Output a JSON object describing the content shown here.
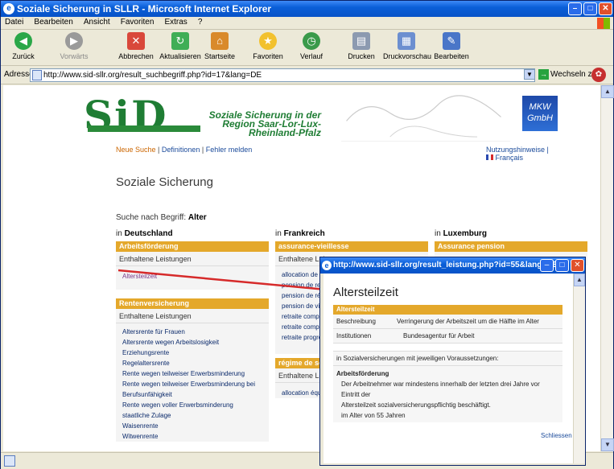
{
  "window": {
    "title": "Soziale Sicherung in SLLR - Microsoft Internet Explorer"
  },
  "menu": [
    "Datei",
    "Bearbeiten",
    "Ansicht",
    "Favoriten",
    "Extras",
    "?"
  ],
  "toolbar": {
    "back": "Zurück",
    "forward": "Vorwärts",
    "stop": "Abbrechen",
    "refresh": "Aktualisieren",
    "home": "Startseite",
    "favorites": "Favoriten",
    "history": "Verlauf",
    "print": "Drucken",
    "preview": "Druckvorschau",
    "edit": "Bearbeiten"
  },
  "address": {
    "label": "Adresse",
    "url": "http://www.sid-sllr.org/result_suchbegriff.php?id=17&lang=DE",
    "go": "Wechseln zu"
  },
  "site": {
    "logo": "SiD",
    "brand": "Soziale Sicherung in der Region Saar-Lor-Lux-Rheinland-Pfalz",
    "partner": "MKW GmbH",
    "nav_left": [
      "Neue Suche",
      "Definitionen",
      "Fehler melden"
    ],
    "nav_right": [
      "Nutzungshinweise",
      "Français"
    ],
    "title": "Soziale Sicherung",
    "search_prefix": "Suche nach Begriff:",
    "search_term": "Alter"
  },
  "columns": [
    {
      "head_prefix": "in",
      "head": "Deutschland",
      "panels": [
        {
          "title": "Arbeitsförderung",
          "sub": "Enthaltene Leistungen",
          "items": [
            "Altersteilzeit"
          ]
        },
        {
          "title": "Rentenversicherung",
          "sub": "Enthaltene Leistungen",
          "items": [
            "Altersrente für Frauen",
            "Altersrente wegen Arbeitslosigkeit",
            "Erziehungsrente",
            "Regelaltersrente",
            "Rente wegen teilweiser Erwerbsminderung",
            "Rente wegen teilweiser Erwerbsminderung bei",
            "Berufsunfähigkeit",
            "Rente wegen voller Erwerbsminderung",
            "staatliche Zulage",
            "Waisenrente",
            "Witwenrente"
          ]
        }
      ]
    },
    {
      "head_prefix": "in",
      "head": "Frankreich",
      "panels": [
        {
          "title": "assurance-vieillesse",
          "sub": "Enthaltene Leistungen",
          "items": [
            "allocation de veuvage",
            "pension de retraite",
            "pension de réversion",
            "pension de vieillesse de veuf ou",
            "retraite complémentaire cadre",
            "retraite complémentaire non-cad",
            "retraite progressive"
          ]
        },
        {
          "title": "régime de solidarité",
          "sub": "Enthaltene Leistungen",
          "items": [
            "allocation équivalent retraite"
          ]
        }
      ]
    },
    {
      "head_prefix": "in",
      "head": "Luxemburg",
      "panels": [
        {
          "title": "Assurance pension",
          "sub": "",
          "items": []
        }
      ]
    }
  ],
  "popup": {
    "title": "http://www.sid-sllr.org/result_leistung.php?id=55&lang=DE ...",
    "heading": "Altersteilzeit",
    "table_head": "Altersteilzeit",
    "rows": [
      {
        "k": "Beschreibung",
        "v": "Verringerung der Arbeitszeit um die Hälfte im Alter"
      },
      {
        "k": "Institutionen",
        "v": "Bundesagentur für Arbeit"
      }
    ],
    "note": "in Sozialversicherungen mit jeweiligen Voraussetzungen:",
    "section": "Arbeitsförderung",
    "lines": [
      "Der Arbeitnehmer war mindestens innerhalb der letzten drei Jahre vor Eintritt der",
      "Altersteilzeit sozialversicherungspflichtig beschäftigt.",
      "im Alter von 55 Jahren"
    ],
    "close": "Schliessen"
  },
  "colors": {
    "accent": "#e4a82b",
    "link": "#1a4a9a",
    "sid_green": "#1f7d34",
    "arrow": "#d62a2a"
  }
}
